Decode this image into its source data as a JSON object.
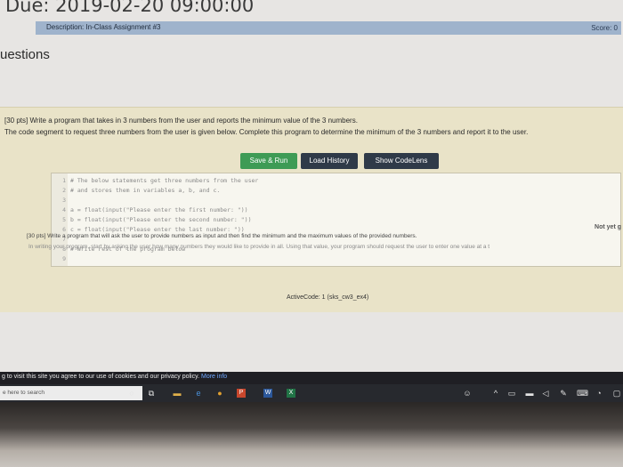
{
  "header": {
    "due": "Due: 2019-02-20 09:00:00",
    "description": "Description: In-Class Assignment #3",
    "score": "Score: 0"
  },
  "section_title": "uestions",
  "question1": {
    "line1": "[30 pts] Write a program that takes in 3 numbers from the user and reports the minimum value of the 3 numbers.",
    "line2": "The code segment to request three numbers from the user is given below. Complete this program to determine the minimum of the 3 numbers and report it to the user.",
    "buttons": {
      "run": "Save & Run",
      "load": "Load History",
      "show": "Show CodeLens"
    },
    "code_lines": [
      {
        "n": "1",
        "text": "# The below statements get three numbers from the user"
      },
      {
        "n": "2",
        "text": "# and stores them in variables a, b, and c."
      },
      {
        "n": "3",
        "text": ""
      },
      {
        "n": "4",
        "text": "a = float(input(\"Please enter the first number: \"))"
      },
      {
        "n": "5",
        "text": "b = float(input(\"Please enter the second number: \"))"
      },
      {
        "n": "6",
        "text": "c = float(input(\"Please enter the last number: \"))"
      },
      {
        "n": "7",
        "text": ""
      },
      {
        "n": "8",
        "text": "# Write rest of the program below"
      },
      {
        "n": "9",
        "text": ""
      }
    ],
    "activecode_label": "ActiveCode: 1 (sks_cw3_ex4)"
  },
  "status": {
    "not_yet": "Not yet g"
  },
  "question2": {
    "line1": "[30 pts] Write a program that will ask the user to provide numbers as input and then find the minimum and the maximum values of the provided numbers.",
    "line2": "In writing your program, start by asking the user how many numbers they would like to provide in all. Using that value, your program should request the user to enter one value at a t"
  },
  "cookie_banner": {
    "text": "g to visit this site you agree to our use of cookies and our privacy policy.",
    "link": "More info"
  },
  "taskbar": {
    "search_placeholder": "e here to search",
    "icons": [
      "cortana-icon",
      "task-view-icon",
      "file-explorer-icon",
      "edge-icon",
      "chrome-icon",
      "powerpoint-icon",
      "word-icon",
      "excel-icon"
    ]
  },
  "colors": {
    "accent_run": "#3e9b55",
    "button_dark": "#2f3a48",
    "description_bar": "#9fb3cc",
    "question_bg": "#e9e3c8"
  }
}
